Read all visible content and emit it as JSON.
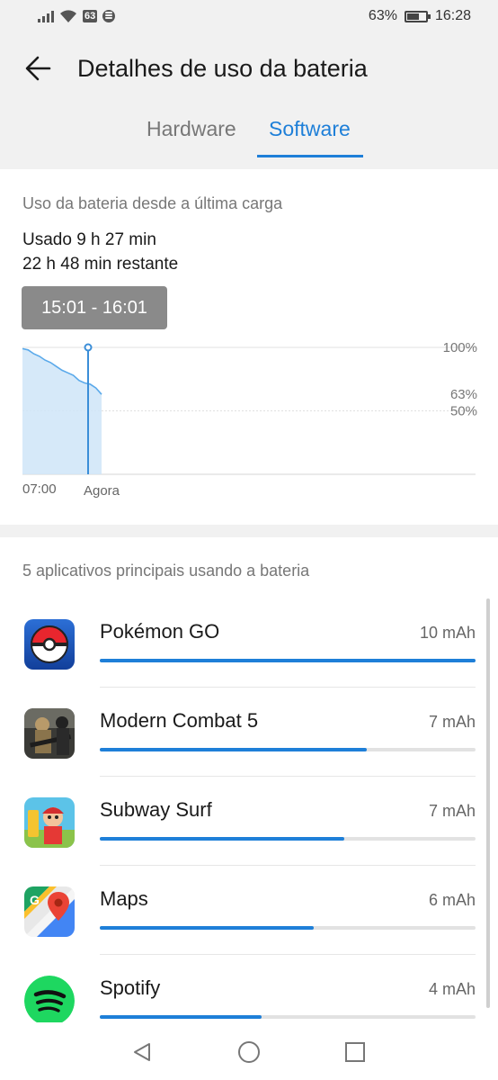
{
  "status_bar": {
    "network_badge": "63",
    "battery_percent": "63%",
    "battery_level": 0.63,
    "time": "16:28",
    "icons": [
      "signal-icon",
      "wifi-icon",
      "network-badge-icon",
      "spotify-notification-icon",
      "battery-icon"
    ]
  },
  "header": {
    "title": "Detalhes de uso da bateria",
    "back_icon": "back-arrow-icon"
  },
  "tabs": [
    {
      "label": "Hardware",
      "active": false
    },
    {
      "label": "Software",
      "active": true
    }
  ],
  "battery_summary": {
    "subtitle": "Uso da bateria desde a última carga",
    "used": "Usado 9 h 27 min",
    "remaining": "22 h 48 min restante",
    "selected_range": "15:01 - 16:01"
  },
  "chart_data": {
    "type": "area",
    "x_labels": [
      "07:00",
      "Agora"
    ],
    "y_labels": [
      "100%",
      "63%",
      "50%"
    ],
    "ylim": [
      0,
      100
    ],
    "series": [
      {
        "x": [
          "07:00",
          "07:40",
          "08:20",
          "09:00",
          "09:40",
          "10:20",
          "11:00",
          "11:40",
          "12:20",
          "13:00",
          "13:40",
          "14:20",
          "15:00",
          "15:40",
          "16:28"
        ],
        "values": [
          99,
          98,
          95,
          93,
          90,
          88,
          85,
          82,
          80,
          78,
          74,
          72,
          71,
          68,
          63
        ]
      }
    ],
    "marker_x": "15:01",
    "accent_color": "#5aa9ea",
    "fill_color": "#cfe5f8"
  },
  "apps": {
    "title": "5 aplicativos principais usando a bateria",
    "items": [
      {
        "name": "Pokémon GO",
        "usage": "10 mAh",
        "value": 10,
        "icon": "pokemon-go-icon"
      },
      {
        "name": "Modern Combat 5",
        "usage": "7 mAh",
        "value": 7,
        "icon": "modern-combat-icon"
      },
      {
        "name": "Subway Surf",
        "usage": "7 mAh",
        "value": 7,
        "icon": "subway-surf-icon"
      },
      {
        "name": "Maps",
        "usage": "6 mAh",
        "value": 6,
        "icon": "maps-icon"
      },
      {
        "name": "Spotify",
        "usage": "4 mAh",
        "value": 4,
        "icon": "spotify-icon"
      }
    ],
    "bar_fractions": [
      1.0,
      0.71,
      0.65,
      0.57,
      0.43
    ]
  },
  "nav_bar": {
    "icons": [
      "back-triangle-icon",
      "home-circle-icon",
      "recents-square-icon"
    ]
  }
}
